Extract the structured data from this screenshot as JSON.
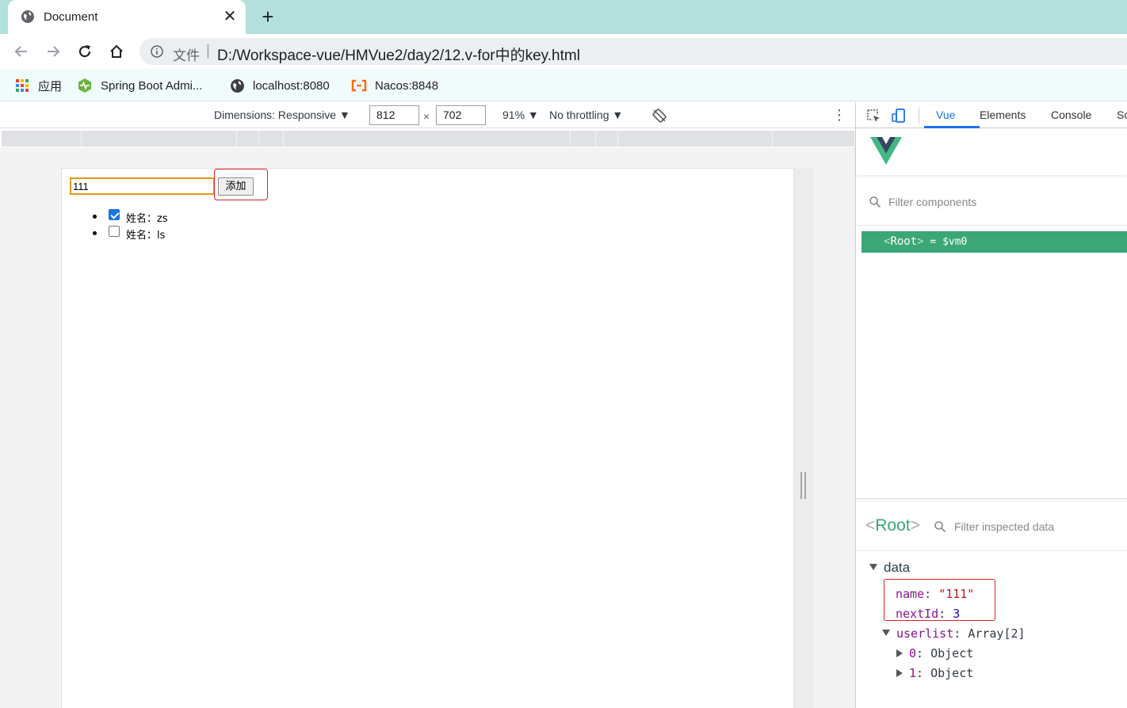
{
  "browser": {
    "tab_title": "Document",
    "close_glyph": "✕",
    "newtab_glyph": "+",
    "scheme_label": "文件",
    "separator": "|",
    "url": "D:/Workspace-vue/HMVue2/day2/12.v-for中的key.html",
    "bookmarks": [
      {
        "label": "应用",
        "icon": "apps-grid-icon"
      },
      {
        "label": "Spring Boot Admi...",
        "icon": "spring-boot-icon"
      },
      {
        "label": "localhost:8080",
        "icon": "globe-icon"
      },
      {
        "label": "Nacos:8848",
        "icon": "nacos-icon"
      }
    ]
  },
  "device_toolbar": {
    "dimensions": "Dimensions: Responsive ▼",
    "width": "812",
    "times": "×",
    "height": "702",
    "zoom": "91% ▼",
    "throttling": "No throttling ▼",
    "more_glyph": "⋮"
  },
  "page": {
    "input_value": "111",
    "add_button": "添加",
    "users": [
      {
        "text": "姓名：zs",
        "checked": true
      },
      {
        "text": "姓名：ls",
        "checked": false
      }
    ]
  },
  "devtools": {
    "tabs": [
      "Vue",
      "Elements",
      "Console",
      "Sc"
    ],
    "active_tab": "Vue",
    "filter_components_placeholder": "Filter components",
    "root_component": {
      "open": "<",
      "name": "Root",
      "close": ">",
      "suffix": " = $vm0"
    },
    "inspector": {
      "open": "<",
      "name": "Root",
      "close": ">",
      "filter_placeholder": "Filter inspected data",
      "section": "data",
      "fields": [
        {
          "key": "name",
          "sep": ": ",
          "value": "\"111\"",
          "kind": "string"
        },
        {
          "key": "nextId",
          "sep": ": ",
          "value": "3",
          "kind": "number"
        },
        {
          "key": "userlist",
          "sep": ": ",
          "value": "Array[2]",
          "kind": "object"
        }
      ],
      "userlist_items": [
        {
          "key": "0",
          "sep": ": ",
          "value": "Object"
        },
        {
          "key": "1",
          "sep": ": ",
          "value": "Object"
        }
      ]
    }
  },
  "colors": {
    "tabstrip": "#b3dfdd",
    "vue_green": "#3ba776",
    "highlight_red": "#e02020",
    "devtools_blue": "#1a73e8"
  }
}
